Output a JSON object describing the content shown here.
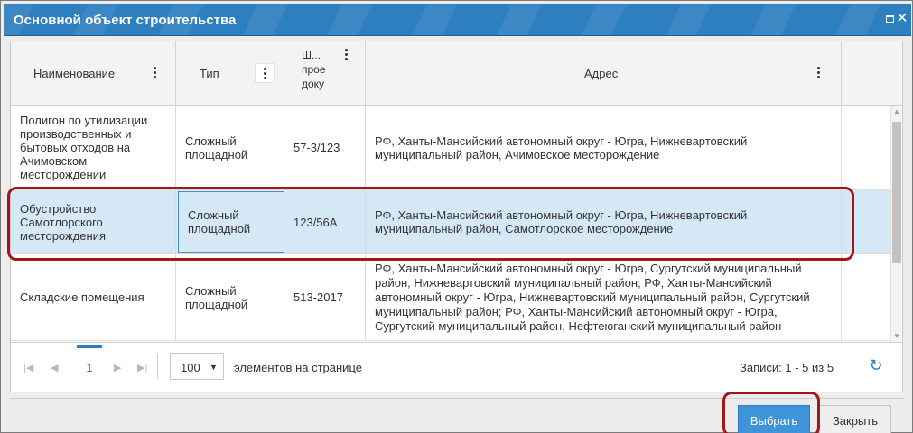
{
  "dialog": {
    "title": "Основной объект строительства"
  },
  "columns": [
    {
      "label": "Наименование"
    },
    {
      "label": "Тип"
    },
    {
      "label": "Ш... прое доку"
    },
    {
      "label": "Адрес"
    }
  ],
  "rows": [
    {
      "name": "Полигон по утилизации производственных и бытовых отходов на Ачимовском месторождении",
      "type": "Сложный площадной",
      "code": "57-3/123",
      "address": "РФ, Ханты-Мансийский автономный округ - Югра, Нижневартовский муниципальный район, Ачимовское месторождение"
    },
    {
      "name": "Обустройство Самотлорского месторождения",
      "type": "Сложный площадной",
      "code": "123/56А",
      "address": "РФ, Ханты-Мансийский автономный округ - Югра, Нижневартовский муниципальный район, Самотлорское месторождение",
      "selected": true
    },
    {
      "name": "Складские помещения",
      "type": "Сложный площадной",
      "code": "513-2017",
      "address": "РФ, Ханты-Мансийский автономный округ - Югра, Сургутский муниципальный район, Нижневартовский муниципальный район; РФ, Ханты-Мансийский автономный округ - Югра, Нижневартовский муниципальный район, Сургутский муниципальный район; РФ, Ханты-Мансийский автономный округ - Югра, Сургутский муниципальный район, Нефтеюганский муниципальный район"
    }
  ],
  "pager": {
    "first_icon": "first-page-icon",
    "prev_icon": "prev-page-icon",
    "next_icon": "next-page-icon",
    "last_icon": "last-page-icon",
    "current_page": "1",
    "page_size": "100",
    "per_page_label": "элементов на странице",
    "records": "Записи: 1 - 5 из 5",
    "refresh_icon": "refresh-icon"
  },
  "buttons": {
    "select": "Выбрать",
    "close": "Закрыть"
  },
  "colors": {
    "title_bar": "#2e7fbf",
    "primary": "#3f94d9",
    "selection": "#d5e8f6",
    "highlight": "#a01818"
  }
}
